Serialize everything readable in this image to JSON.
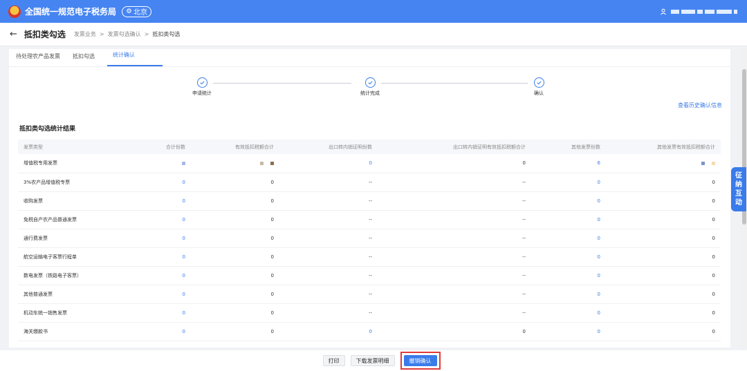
{
  "header": {
    "site_title": "全国统一规范电子税务局",
    "location": "北京"
  },
  "breadcrumb": {
    "back_icon": "arrow-left-icon",
    "page_title": "抵扣类勾选",
    "items": [
      "发票业务",
      "发票勾选确认",
      "抵扣类勾选"
    ],
    "separator": ">"
  },
  "tabs": [
    {
      "label": "待处理农产品发票"
    },
    {
      "label": "抵扣勾选"
    },
    {
      "label": "统计确认",
      "active": true
    }
  ],
  "steps": [
    {
      "label": "申请统计",
      "done": true
    },
    {
      "label": "统计完成",
      "done": true
    },
    {
      "label": "确认",
      "done": true
    }
  ],
  "history_link": "查看历史确认信息",
  "section_title": "抵扣类勾选统计结果",
  "table": {
    "columns": [
      "发票类型",
      "合计份数",
      "有效抵扣税额合计",
      "出口转内销证明份数",
      "出口转内销证明有效抵扣税额合计",
      "其他发票份数",
      "其他发票有效抵扣税额合计"
    ],
    "rows": [
      {
        "type": "增值税专用发票",
        "total": "",
        "tax": "",
        "export_count": "0",
        "export_tax": "0",
        "other_count": "6",
        "other_tax": ""
      },
      {
        "type": "3%农产品增值税专票",
        "total": "0",
        "tax": "0",
        "export_count": "--",
        "export_tax": "--",
        "other_count": "0",
        "other_tax": "0"
      },
      {
        "type": "收购发票",
        "total": "0",
        "tax": "0",
        "export_count": "--",
        "export_tax": "--",
        "other_count": "0",
        "other_tax": "0"
      },
      {
        "type": "免税自产农产品普通发票",
        "total": "0",
        "tax": "0",
        "export_count": "--",
        "export_tax": "--",
        "other_count": "0",
        "other_tax": "0"
      },
      {
        "type": "通行费发票",
        "total": "0",
        "tax": "0",
        "export_count": "--",
        "export_tax": "--",
        "other_count": "0",
        "other_tax": "0"
      },
      {
        "type": "航空运输电子客票行程单",
        "total": "0",
        "tax": "0",
        "export_count": "--",
        "export_tax": "--",
        "other_count": "0",
        "other_tax": "0"
      },
      {
        "type": "数电发票（铁路电子客票）",
        "total": "0",
        "tax": "0",
        "export_count": "--",
        "export_tax": "--",
        "other_count": "0",
        "other_tax": "0"
      },
      {
        "type": "其他普通发票",
        "total": "0",
        "tax": "0",
        "export_count": "--",
        "export_tax": "--",
        "other_count": "0",
        "other_tax": "0"
      },
      {
        "type": "机动车统一销售发票",
        "total": "0",
        "tax": "0",
        "export_count": "--",
        "export_tax": "--",
        "other_count": "0",
        "other_tax": "0"
      },
      {
        "type": "海关缴款书",
        "total": "0",
        "tax": "0",
        "export_count": "0",
        "export_tax": "0",
        "other_count": "0",
        "other_tax": "0"
      }
    ]
  },
  "actions": {
    "print": "打印",
    "download": "下载发票明细",
    "revoke": "撤销确认"
  },
  "side_tab": [
    "征",
    "纳",
    "互",
    "动"
  ],
  "colors": {
    "header_bg": "#4684f2",
    "accent": "#3a7bea",
    "highlight_border": "#e03a3a"
  }
}
